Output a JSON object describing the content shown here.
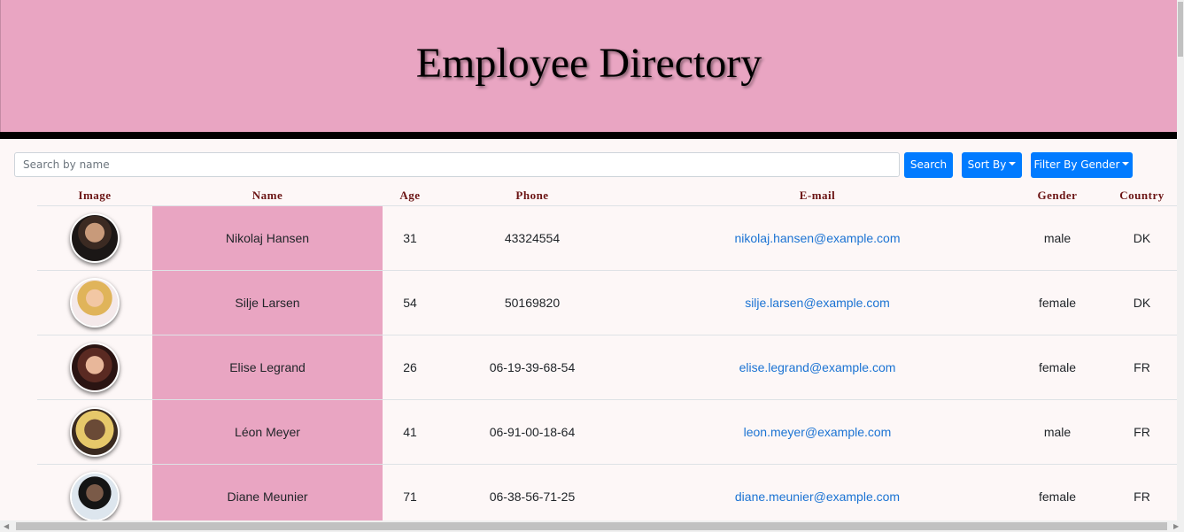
{
  "header": {
    "title": "Employee Directory"
  },
  "toolbar": {
    "search_placeholder": "Search by name",
    "search_button": "Search",
    "sort_button": "Sort By",
    "filter_button": "Filter By Gender"
  },
  "colors": {
    "header_bg": "#e9a5c2",
    "accent": "#007bff",
    "link": "#1b73d3"
  },
  "table": {
    "columns": [
      "Image",
      "Name",
      "Age",
      "Phone",
      "E-mail",
      "Gender",
      "Country"
    ],
    "rows": [
      {
        "name": "Nikolaj Hansen",
        "age": "31",
        "phone": "43324554",
        "email": "nikolaj.hansen@example.com",
        "gender": "male",
        "country": "DK"
      },
      {
        "name": "Silje Larsen",
        "age": "54",
        "phone": "50169820",
        "email": "silje.larsen@example.com",
        "gender": "female",
        "country": "DK"
      },
      {
        "name": "Elise Legrand",
        "age": "26",
        "phone": "06-19-39-68-54",
        "email": "elise.legrand@example.com",
        "gender": "female",
        "country": "FR"
      },
      {
        "name": "Léon Meyer",
        "age": "41",
        "phone": "06-91-00-18-64",
        "email": "leon.meyer@example.com",
        "gender": "male",
        "country": "FR"
      },
      {
        "name": "Diane Meunier",
        "age": "71",
        "phone": "06-38-56-71-25",
        "email": "diane.meunier@example.com",
        "gender": "female",
        "country": "FR"
      }
    ]
  }
}
